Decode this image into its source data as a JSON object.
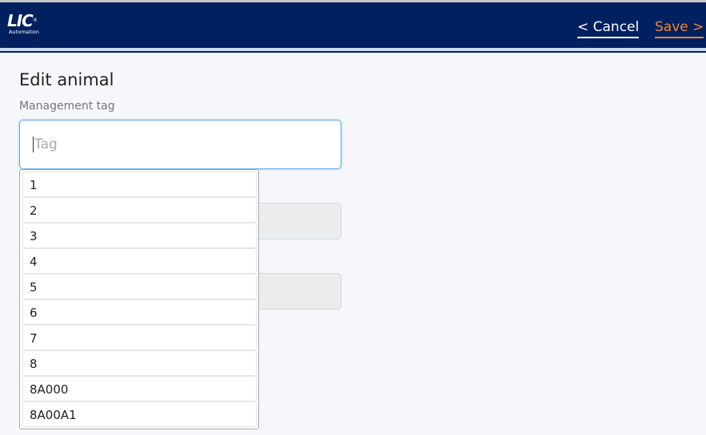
{
  "header": {
    "logo_text": "LIC",
    "logo_sub": "Automation",
    "cancel_label": "< Cancel",
    "save_label": "Save >",
    "colors": {
      "navy": "#002060",
      "save": "#f08a2c"
    }
  },
  "page": {
    "title": "Edit animal",
    "field_label": "Management tag",
    "input_placeholder": "Tag",
    "input_value": ""
  },
  "dropdown": {
    "options": [
      "1",
      "2",
      "3",
      "4",
      "5",
      "6",
      "7",
      "8",
      "8A000",
      "8A00A1"
    ]
  }
}
